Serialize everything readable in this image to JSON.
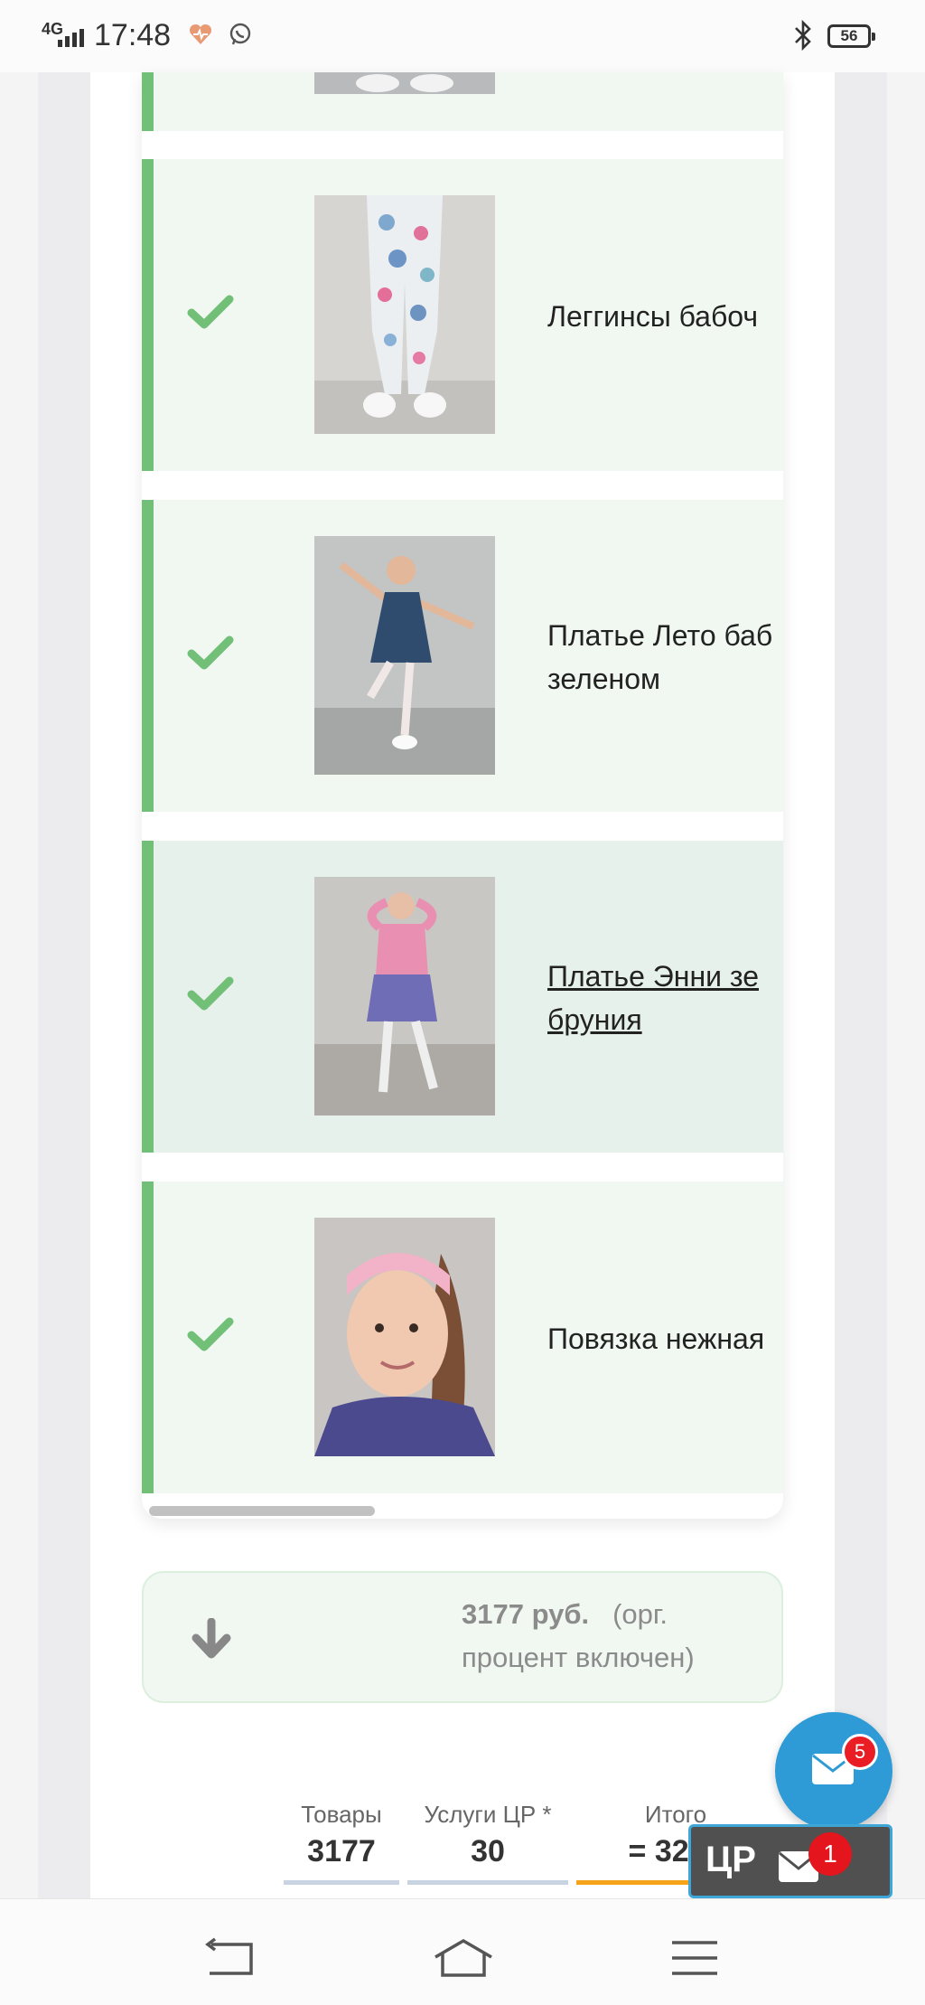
{
  "status_bar": {
    "network": "4G",
    "time": "17:48",
    "battery": "56"
  },
  "products": [
    {
      "name": "",
      "checked": true,
      "link": false
    },
    {
      "name": "Леггинсы бабоч",
      "checked": true,
      "link": false
    },
    {
      "name": "Платье Лето баб\nзеленом",
      "checked": true,
      "link": false
    },
    {
      "name": "Платье Энни зе\nбруния",
      "checked": true,
      "link": true
    },
    {
      "name": "Повязка нежная",
      "checked": true,
      "link": false
    }
  ],
  "price_summary": {
    "amount": "3177 руб.",
    "note": "(орг. процент включен)"
  },
  "totals": {
    "goods_label": "Товары",
    "goods_value": "3177",
    "services_label": "Услуги ЦР *",
    "services_value": "30",
    "total_label": "Итого",
    "total_value": "= 3207"
  },
  "floating": {
    "messages_badge": "5",
    "cr_label": "ЦР",
    "cr_badge": "1"
  },
  "colors": {
    "accent_green": "#72bf78",
    "row_bg": "#f1f8f2",
    "fab_blue": "#2e9bd6",
    "badge_red": "#ea1c24",
    "total_underline": "#f5a419"
  }
}
